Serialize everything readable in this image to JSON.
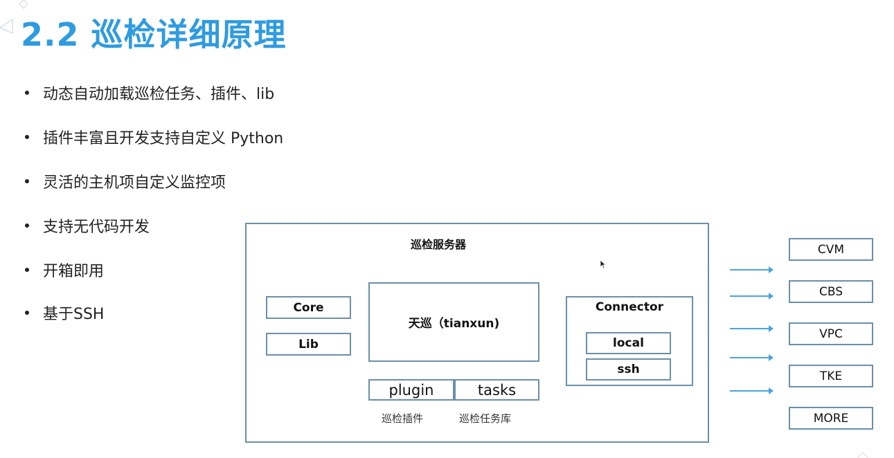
{
  "slide": {
    "title": "2.2 巡检详细原理",
    "bullets": [
      "动态自动加载巡检任务、插件、lib",
      "插件丰富且开发支持自定义 Python",
      "灵活的主机项自定义监控项",
      "支持无代码开发",
      "开箱即用",
      "基于SSH"
    ]
  },
  "diagram": {
    "server_title": "巡检服务器",
    "core": "Core",
    "lib": "Lib",
    "tianxun": "天巡（tianxun)",
    "plugin": "plugin",
    "tasks": "tasks",
    "plugin_caption": "巡检插件",
    "tasks_caption": "巡检任务库",
    "connector": "Connector",
    "local": "local",
    "ssh": "ssh",
    "targets": [
      "CVM",
      "CBS",
      "VPC",
      "TKE",
      "MORE"
    ]
  },
  "colors": {
    "title": "#2f9be0",
    "box_border": "#6a8fa8",
    "arrow": "#4aa3df"
  }
}
